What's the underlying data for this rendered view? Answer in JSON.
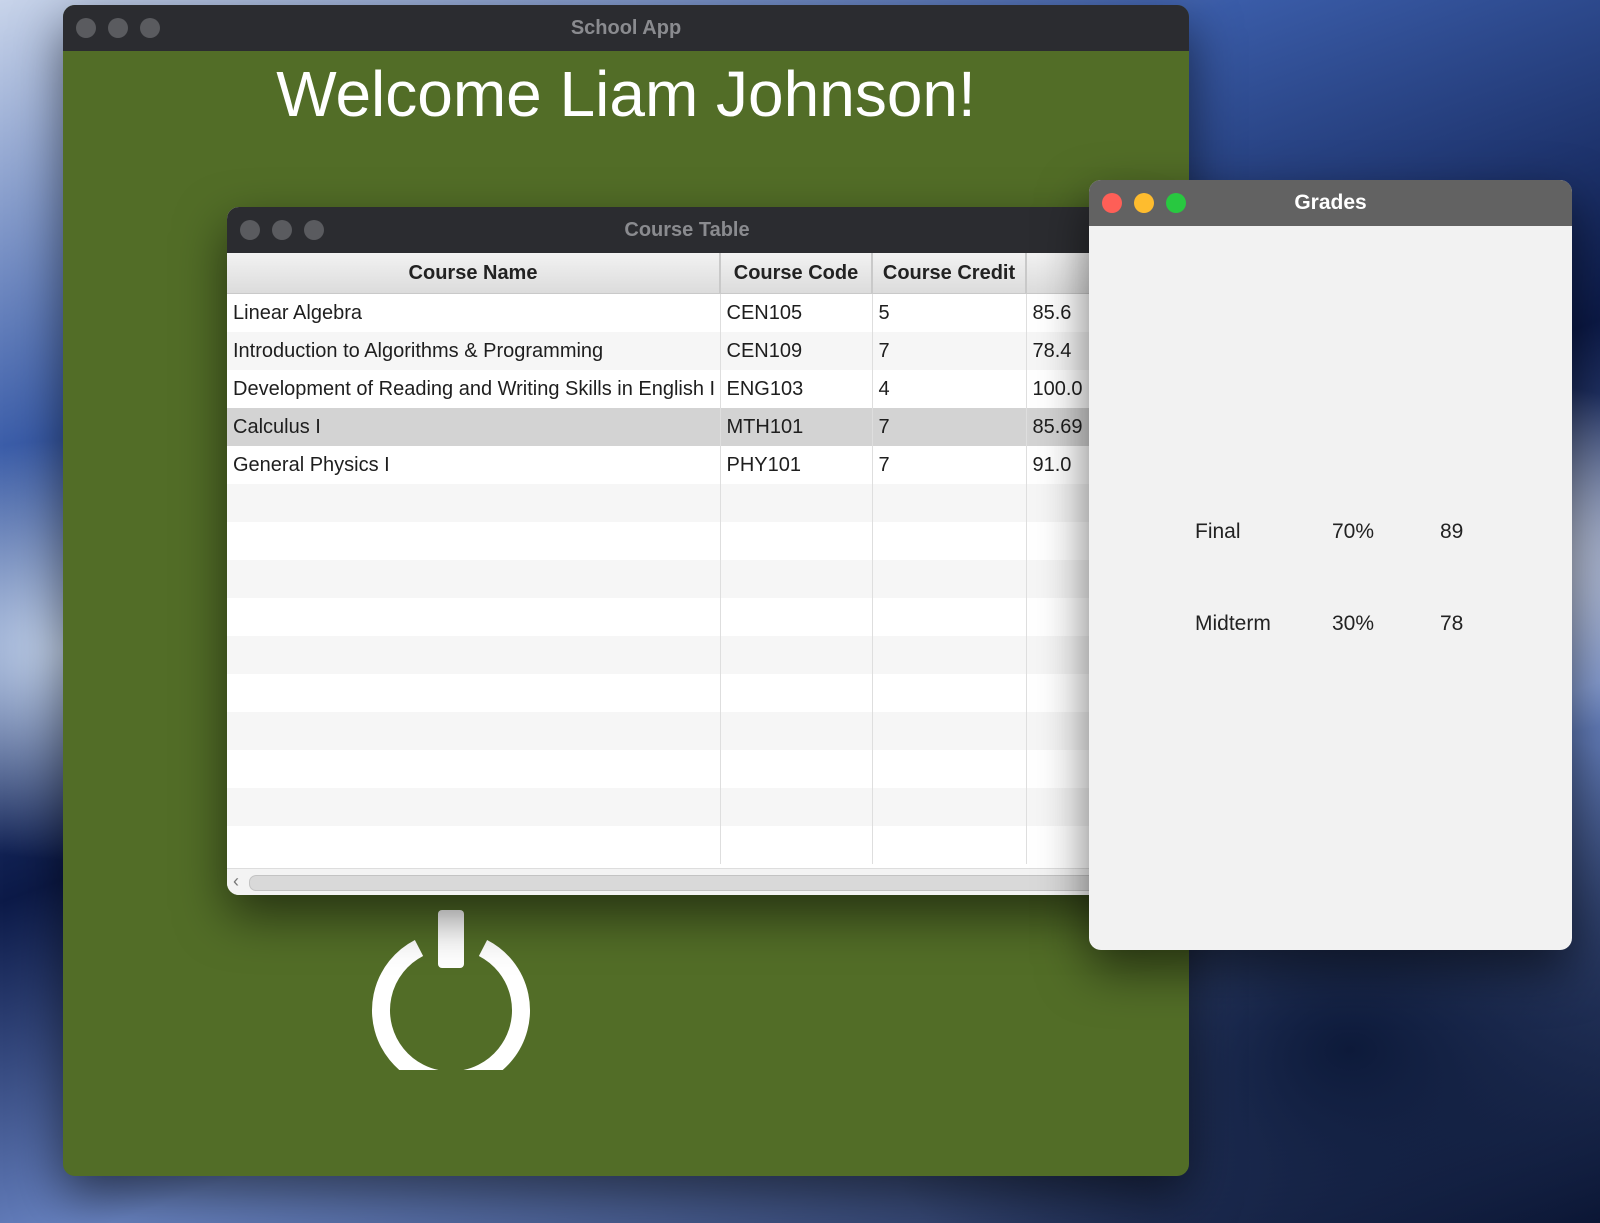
{
  "school_app": {
    "title": "School App",
    "welcome": "Welcome Liam Johnson!",
    "power_icon": "power-icon"
  },
  "course_table": {
    "title": "Course Table",
    "headers": [
      "Course Name",
      "Course Code",
      "Course Credit",
      ""
    ],
    "rows": [
      {
        "name": "Linear Algebra",
        "code": "CEN105",
        "credit": "5",
        "grade": "85.6"
      },
      {
        "name": "Introduction to Algorithms & Programming",
        "code": "CEN109",
        "credit": "7",
        "grade": "78.4"
      },
      {
        "name": "Development of Reading and Writing Skills in English I",
        "code": "ENG103",
        "credit": "4",
        "grade": "100.0"
      },
      {
        "name": "Calculus I",
        "code": "MTH101",
        "credit": "7",
        "grade": "85.69"
      },
      {
        "name": "General Physics I",
        "code": "PHY101",
        "credit": "7",
        "grade": "91.0"
      }
    ],
    "selected_row": 3
  },
  "grades": {
    "title": "Grades",
    "items": [
      {
        "type": "Final",
        "weight": "70%",
        "score": "89"
      },
      {
        "type": "Midterm",
        "weight": "30%",
        "score": "78"
      }
    ]
  }
}
